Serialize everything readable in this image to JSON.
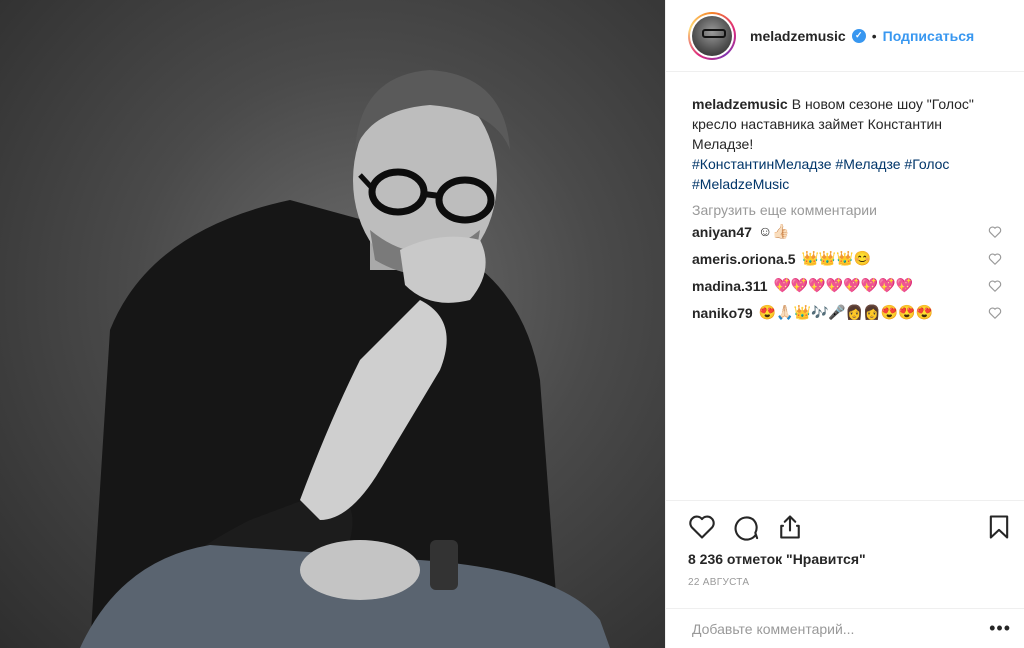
{
  "post": {
    "username": "meladzemusic",
    "verified_mark": "✓",
    "separator": "•",
    "follow_label": "Подписаться",
    "caption_user": "meladzemusic",
    "caption_text": "В новом сезоне шоу \"Голос\" кресло наставника займет Константин Меладзе!",
    "hashtags": [
      "#КонстантинМеладзе",
      "#Меладзе",
      "#Голос",
      "#MeladzeMusic"
    ],
    "load_more_label": "Загрузить еще комментарии",
    "likes": "8 236 отметок \"Нравится\"",
    "date": "22 августа",
    "add_comment_placeholder": "Добавьте комментарий...",
    "more_label": "•••"
  },
  "comments": [
    {
      "user": "aniyan47",
      "text": "☺👍🏻"
    },
    {
      "user": "ameris.oriona.5",
      "text": "👑👑👑😊"
    },
    {
      "user": "madina.311",
      "text": "💖💖💖💖💖💖💖💖"
    },
    {
      "user": "naniko79",
      "text": "😍🙏🏻👑🎶🎤👩👩😍😍😍"
    }
  ],
  "icons": {
    "like": "heart-icon",
    "comment": "comment-icon",
    "share": "share-icon",
    "save": "bookmark-icon",
    "comment_like": "heart-icon"
  },
  "colors": {
    "link": "#3897f0",
    "hashtag": "#003569",
    "muted": "#999999",
    "text": "#262626"
  }
}
